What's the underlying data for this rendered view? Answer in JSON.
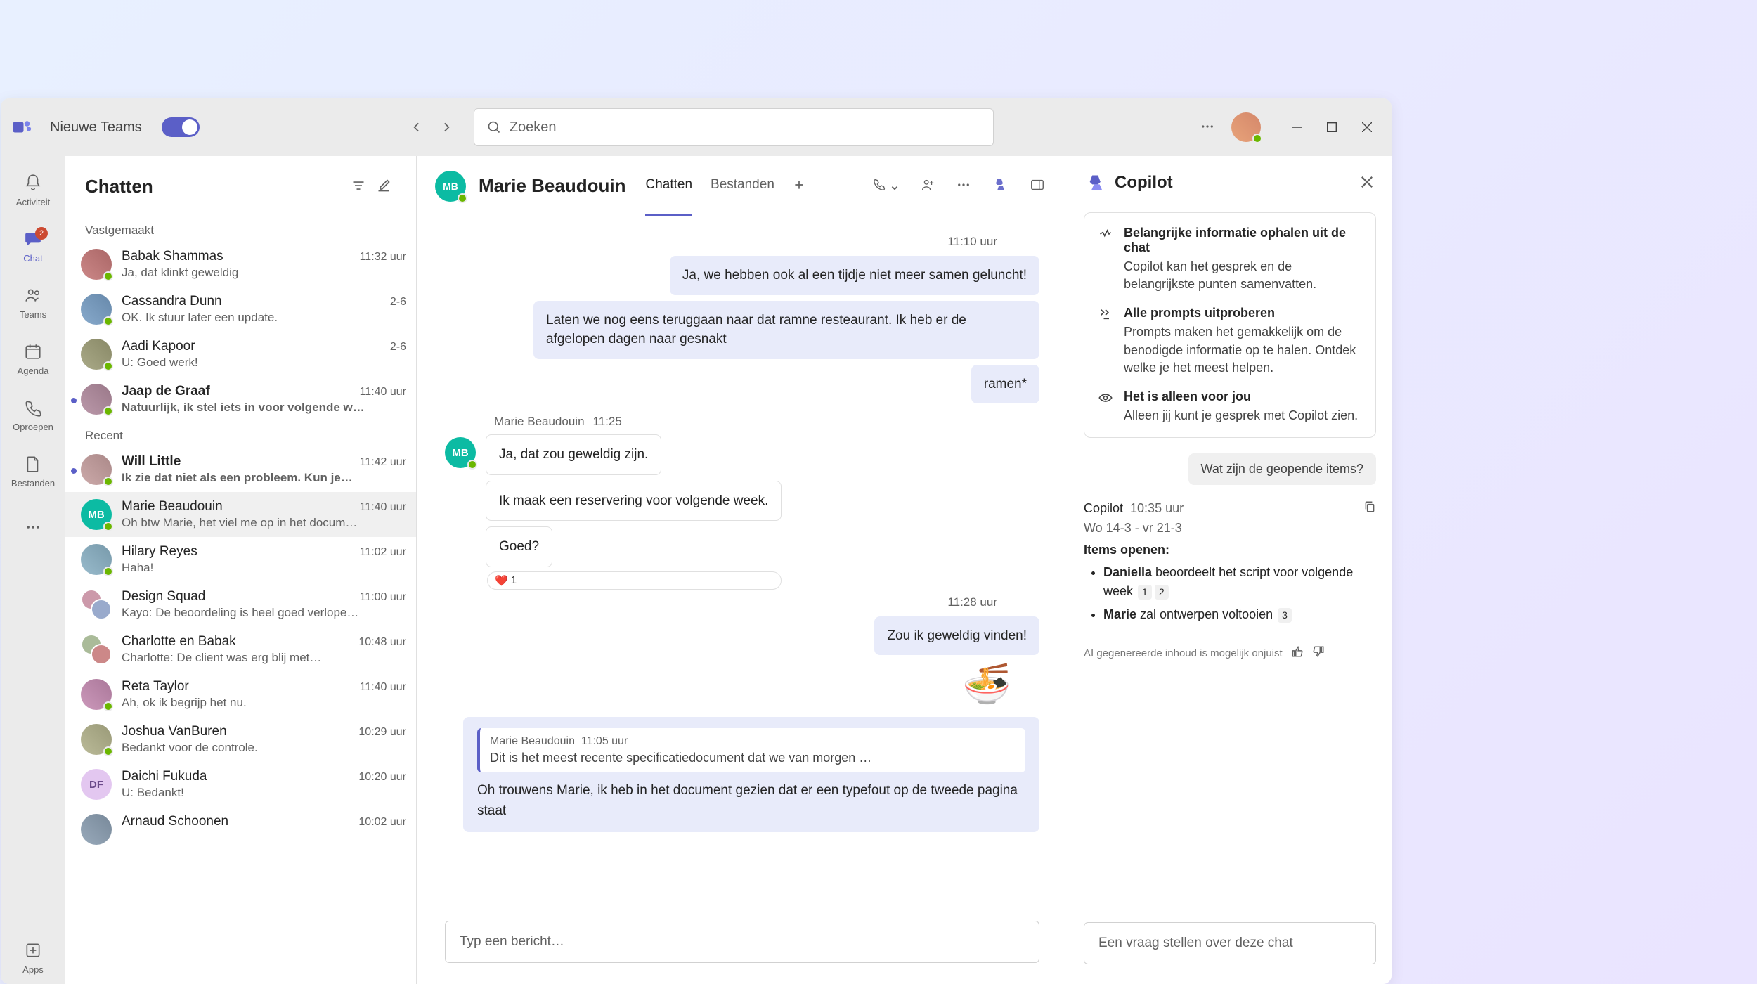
{
  "titlebar": {
    "toggle_label": "Nieuwe Teams",
    "search_placeholder": "Zoeken"
  },
  "rail": {
    "items": [
      {
        "label": "Activiteit"
      },
      {
        "label": "Chat",
        "badge": "2"
      },
      {
        "label": "Teams"
      },
      {
        "label": "Agenda"
      },
      {
        "label": "Oproepen"
      },
      {
        "label": "Bestanden"
      }
    ],
    "apps_label": "Apps"
  },
  "chatlist": {
    "title": "Chatten",
    "pinned_label": "Vastgemaakt",
    "recent_label": "Recent",
    "pinned": [
      {
        "name": "Babak Shammas",
        "preview": "Ja, dat klinkt geweldig",
        "time": "11:32 uur"
      },
      {
        "name": "Cassandra Dunn",
        "preview": "OK. Ik stuur later een update.",
        "time": "2-6"
      },
      {
        "name": "Aadi Kapoor",
        "preview": "U: Goed werk!",
        "time": "2-6"
      },
      {
        "name": "Jaap de Graaf",
        "preview": "Natuurlijk, ik stel iets in voor volgende w…",
        "time": "11:40 uur"
      }
    ],
    "recent": [
      {
        "name": "Will Little",
        "preview": "Ik zie dat niet als een probleem. Kun je…",
        "time": "11:42 uur"
      },
      {
        "name": "Marie Beaudouin",
        "preview": "Oh btw Marie, het viel me op in het docum…",
        "time": "11:40 uur",
        "initials": "MB"
      },
      {
        "name": "Hilary Reyes",
        "preview": "Haha!",
        "time": "11:02 uur"
      },
      {
        "name": "Design Squad",
        "preview": "Kayo: De beoordeling is heel goed verlope…",
        "time": "11:00 uur"
      },
      {
        "name": "Charlotte en Babak",
        "preview": "Charlotte: De client was erg blij met…",
        "time": "10:48 uur"
      },
      {
        "name": "Reta Taylor",
        "preview": "Ah, ok ik begrijp het nu.",
        "time": "11:40 uur"
      },
      {
        "name": "Joshua VanBuren",
        "preview": "Bedankt voor de controle.",
        "time": "10:29 uur"
      },
      {
        "name": "Daichi Fukuda",
        "preview": "U: Bedankt!",
        "time": "10:20 uur",
        "initials": "DF"
      },
      {
        "name": "Arnaud Schoonen",
        "preview": "",
        "time": "10:02 uur"
      }
    ]
  },
  "convo": {
    "contact_name": "Marie Beaudouin",
    "contact_initials": "MB",
    "tabs": {
      "chat": "Chatten",
      "files": "Bestanden"
    },
    "time1": "11:10 uur",
    "out1": "Ja, we hebben ook al een tijdje niet meer samen geluncht!",
    "out2": "Laten we nog eens teruggaan naar dat ramne resteaurant. Ik heb er de afgelopen dagen naar gesnakt",
    "out3": "ramen*",
    "in_meta_name": "Marie Beaudouin",
    "in_meta_time": "11:25",
    "in1": "Ja, dat zou geweldig zijn.",
    "in2": "Ik maak een reservering voor volgende week.",
    "in3": "Goed?",
    "reaction_count": "1",
    "time2": "11:28 uur",
    "out4": "Zou ik geweldig vinden!",
    "emoji": "🍜",
    "reply_quote_hdr_name": "Marie Beaudouin",
    "reply_quote_hdr_time": "11:05 uur",
    "reply_quote_body": "Dit is het meest recente specificatiedocument dat we van morgen …",
    "reply_text": "Oh trouwens Marie, ik heb in het document gezien dat er een typefout op de tweede pagina staat",
    "composer_placeholder": "Typ een bericht…"
  },
  "copilot": {
    "title": "Copilot",
    "card": [
      {
        "title": "Belangrijke informatie ophalen uit de chat",
        "body": "Copilot kan het gesprek en de belangrijkste punten samenvatten."
      },
      {
        "title": "Alle prompts uitproberen",
        "body": "Prompts maken het gemakkelijk om de benodigde informatie op te halen. Ontdek welke je het meest helpen."
      },
      {
        "title": "Het is alleen voor jou",
        "body": "Alleen jij kunt je gesprek met Copilot zien."
      }
    ],
    "suggestion": "Wat zijn de geopende items?",
    "resp_name": "Copilot",
    "resp_time": "10:35 uur",
    "resp_dates": "Wo 14-3 - vr 21-3",
    "resp_section": "Items openen:",
    "resp_items": [
      {
        "bold": "Daniella",
        "rest": " beoordeelt het script voor volgende week",
        "badges": [
          "1",
          "2"
        ]
      },
      {
        "bold": "Marie",
        "rest": " zal ontwerpen voltooien",
        "badges": [
          "3"
        ]
      }
    ],
    "disclaimer": "AI gegenereerde inhoud is mogelijk onjuist",
    "input_placeholder": "Een vraag stellen over deze chat"
  }
}
